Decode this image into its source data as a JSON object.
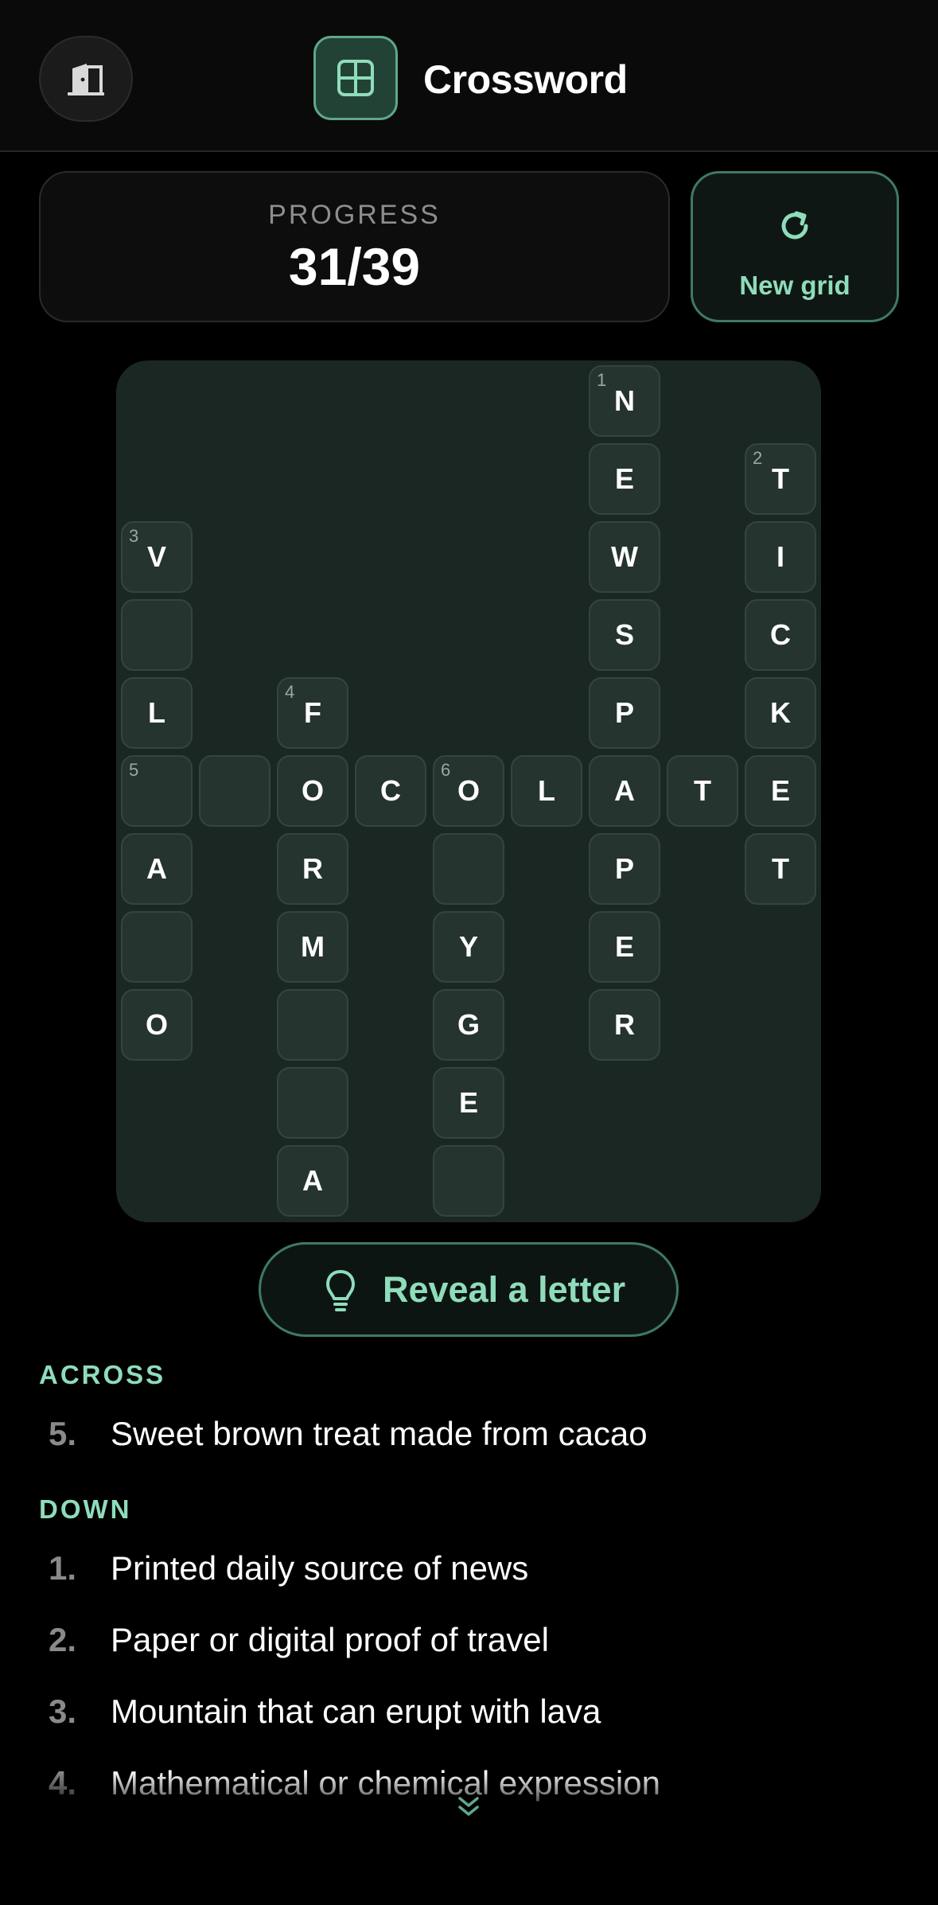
{
  "header": {
    "title": "Crossword",
    "exit_icon": "door-exit-icon",
    "app_icon": "grid-icon"
  },
  "progress": {
    "label": "PROGRESS",
    "value": "31/39"
  },
  "new_grid": {
    "label": "New grid",
    "icon": "refresh-icon"
  },
  "grid": {
    "rows": 11,
    "cols": 9,
    "cells": [
      {
        "r": 0,
        "c": 6,
        "letter": "N",
        "num": "1"
      },
      {
        "r": 1,
        "c": 6,
        "letter": "E"
      },
      {
        "r": 1,
        "c": 8,
        "letter": "T",
        "num": "2"
      },
      {
        "r": 2,
        "c": 0,
        "letter": "V",
        "num": "3"
      },
      {
        "r": 2,
        "c": 6,
        "letter": "W"
      },
      {
        "r": 2,
        "c": 8,
        "letter": "I"
      },
      {
        "r": 3,
        "c": 0,
        "letter": ""
      },
      {
        "r": 3,
        "c": 6,
        "letter": "S"
      },
      {
        "r": 3,
        "c": 8,
        "letter": "C"
      },
      {
        "r": 4,
        "c": 0,
        "letter": "L"
      },
      {
        "r": 4,
        "c": 2,
        "letter": "F",
        "num": "4"
      },
      {
        "r": 4,
        "c": 6,
        "letter": "P"
      },
      {
        "r": 4,
        "c": 8,
        "letter": "K"
      },
      {
        "r": 5,
        "c": 0,
        "letter": "",
        "num": "5"
      },
      {
        "r": 5,
        "c": 1,
        "letter": ""
      },
      {
        "r": 5,
        "c": 2,
        "letter": "O"
      },
      {
        "r": 5,
        "c": 3,
        "letter": "C"
      },
      {
        "r": 5,
        "c": 4,
        "letter": "O",
        "num": "6"
      },
      {
        "r": 5,
        "c": 5,
        "letter": "L"
      },
      {
        "r": 5,
        "c": 6,
        "letter": "A"
      },
      {
        "r": 5,
        "c": 7,
        "letter": "T"
      },
      {
        "r": 5,
        "c": 8,
        "letter": "E"
      },
      {
        "r": 6,
        "c": 0,
        "letter": "A"
      },
      {
        "r": 6,
        "c": 2,
        "letter": "R"
      },
      {
        "r": 6,
        "c": 4,
        "letter": ""
      },
      {
        "r": 6,
        "c": 6,
        "letter": "P"
      },
      {
        "r": 6,
        "c": 8,
        "letter": "T"
      },
      {
        "r": 7,
        "c": 0,
        "letter": ""
      },
      {
        "r": 7,
        "c": 2,
        "letter": "M"
      },
      {
        "r": 7,
        "c": 4,
        "letter": "Y"
      },
      {
        "r": 7,
        "c": 6,
        "letter": "E"
      },
      {
        "r": 8,
        "c": 0,
        "letter": "O"
      },
      {
        "r": 8,
        "c": 2,
        "letter": ""
      },
      {
        "r": 8,
        "c": 4,
        "letter": "G"
      },
      {
        "r": 8,
        "c": 6,
        "letter": "R"
      },
      {
        "r": 9,
        "c": 2,
        "letter": ""
      },
      {
        "r": 9,
        "c": 4,
        "letter": "E"
      },
      {
        "r": 10,
        "c": 2,
        "letter": "A"
      },
      {
        "r": 10,
        "c": 4,
        "letter": ""
      }
    ]
  },
  "reveal": {
    "label": "Reveal a letter",
    "icon": "lightbulb-icon"
  },
  "clues": {
    "across_title": "ACROSS",
    "across": [
      {
        "num": "5.",
        "text": "Sweet brown treat made from cacao"
      }
    ],
    "down_title": "DOWN",
    "down": [
      {
        "num": "1.",
        "text": "Printed daily source of news"
      },
      {
        "num": "2.",
        "text": "Paper or digital proof of travel"
      },
      {
        "num": "3.",
        "text": "Mountain that can erupt with lava"
      },
      {
        "num": "4.",
        "text": "Mathematical or chemical expression"
      }
    ]
  },
  "colors": {
    "accent": "#8fdcbb",
    "accent_border": "#3f7a63",
    "board_bg": "#1b2723",
    "cell_bg": "#26342f"
  },
  "scroll_icon": "double-chevron-down-icon"
}
